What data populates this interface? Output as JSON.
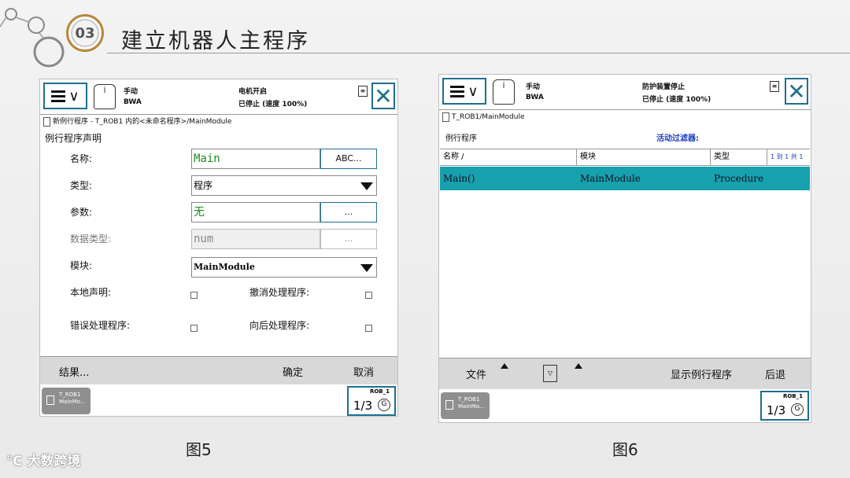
{
  "slide": {
    "badge": "03",
    "title": "建立机器人主程序",
    "watermark": "大数跨境"
  },
  "fig5": {
    "caption": "图5",
    "status": {
      "mode": "手动",
      "controller": "BWA",
      "motor": "电机开启",
      "state": "已停止 (速度 100%)"
    },
    "breadcrumb": "新例行程序 - T_ROB1 内的<未命名程序>/MainModule",
    "section": "例行程序声明",
    "fields": {
      "name": {
        "label": "名称:",
        "value": "Main",
        "button": "ABC..."
      },
      "type": {
        "label": "类型:",
        "value": "程序"
      },
      "params": {
        "label": "参数:",
        "value": "无",
        "button": "..."
      },
      "datatype": {
        "label": "数据类型:",
        "value": "num",
        "button": "..."
      },
      "module": {
        "label": "模块:",
        "value": "MainModule"
      },
      "local": {
        "label": "本地声明:"
      },
      "undo": {
        "label": "撤消处理程序:"
      },
      "error": {
        "label": "错误处理程序:"
      },
      "backward": {
        "label": "向后处理程序:"
      }
    },
    "buttons": {
      "result": "结果...",
      "ok": "确定",
      "cancel": "取消"
    },
    "task": {
      "line1": "T_ROB1",
      "line2": "MainMo..."
    },
    "quickset": {
      "rob": "ROB_1",
      "frac": "1/3",
      "speed": "G"
    }
  },
  "fig6": {
    "caption": "图6",
    "status": {
      "mode": "手动",
      "controller": "BWA",
      "motor": "防护装置停止",
      "state": "已停止 (速度 100%)"
    },
    "breadcrumb": "T_ROB1/MainModule",
    "section": "例行程序",
    "filter": "活动过滤器:",
    "columns": [
      "名称 /",
      "模块",
      "类型"
    ],
    "pager": "1 到 1 共 1",
    "rows": [
      {
        "name": "Main()",
        "module": "MainModule",
        "type": "Procedure"
      }
    ],
    "buttons": {
      "file": "文件",
      "show": "显示例行程序",
      "back": "后退"
    },
    "task": {
      "line1": "T_ROB1",
      "line2": "MainMo..."
    },
    "quickset": {
      "rob": "ROB_1",
      "frac": "1/3",
      "speed": "G"
    }
  }
}
